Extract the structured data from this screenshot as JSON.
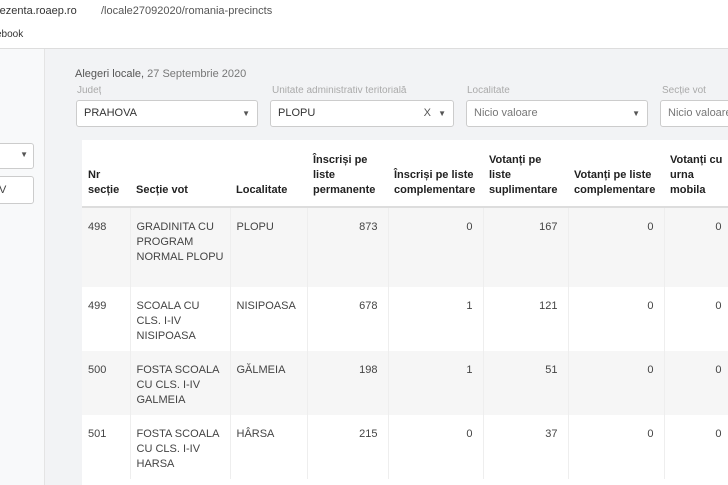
{
  "browser": {
    "url_host": "rezenta.roaep.ro",
    "url_path": "/locale27092020/romania-precincts",
    "bookmark": "ebook"
  },
  "sidebar": {
    "field_value": "V"
  },
  "header": {
    "election": "Alegeri locale,",
    "date": "27 Septembrie 2020"
  },
  "filters": [
    {
      "label": "Județ",
      "value": "PRAHOVA",
      "placeholder": ""
    },
    {
      "label": "Unitate administrativ teritorială",
      "value": "PLOPU",
      "clear": "X"
    },
    {
      "label": "Localitate",
      "value": "",
      "placeholder": "Nicio valoare"
    },
    {
      "label": "Secție vot",
      "value": "",
      "placeholder": "Nicio valoare"
    }
  ],
  "table": {
    "headers": [
      "Nr secție",
      "Secție vot",
      "Localitate",
      "Înscriși pe liste permanente",
      "Înscriși pe liste complementare",
      "Votanți pe liste suplimentare",
      "Votanți pe liste complementare",
      "Votanți cu urna mobila"
    ],
    "rows": [
      [
        "498",
        "GRADINITA CU PROGRAM NORMAL PLOPU",
        "PLOPU",
        "873",
        "0",
        "167",
        "0",
        "0"
      ],
      [
        "499",
        "SCOALA CU CLS. I-IV NISIPOASA",
        "NISIPOASA",
        "678",
        "1",
        "121",
        "0",
        "0"
      ],
      [
        "500",
        "FOSTA SCOALA CU CLS. I-IV GALMEIA",
        "GĂLMEIA",
        "198",
        "1",
        "51",
        "0",
        "0"
      ],
      [
        "501",
        "FOSTA SCOALA CU CLS. I-IV HARSA",
        "HÂRSA",
        "215",
        "0",
        "37",
        "0",
        "0"
      ]
    ]
  }
}
